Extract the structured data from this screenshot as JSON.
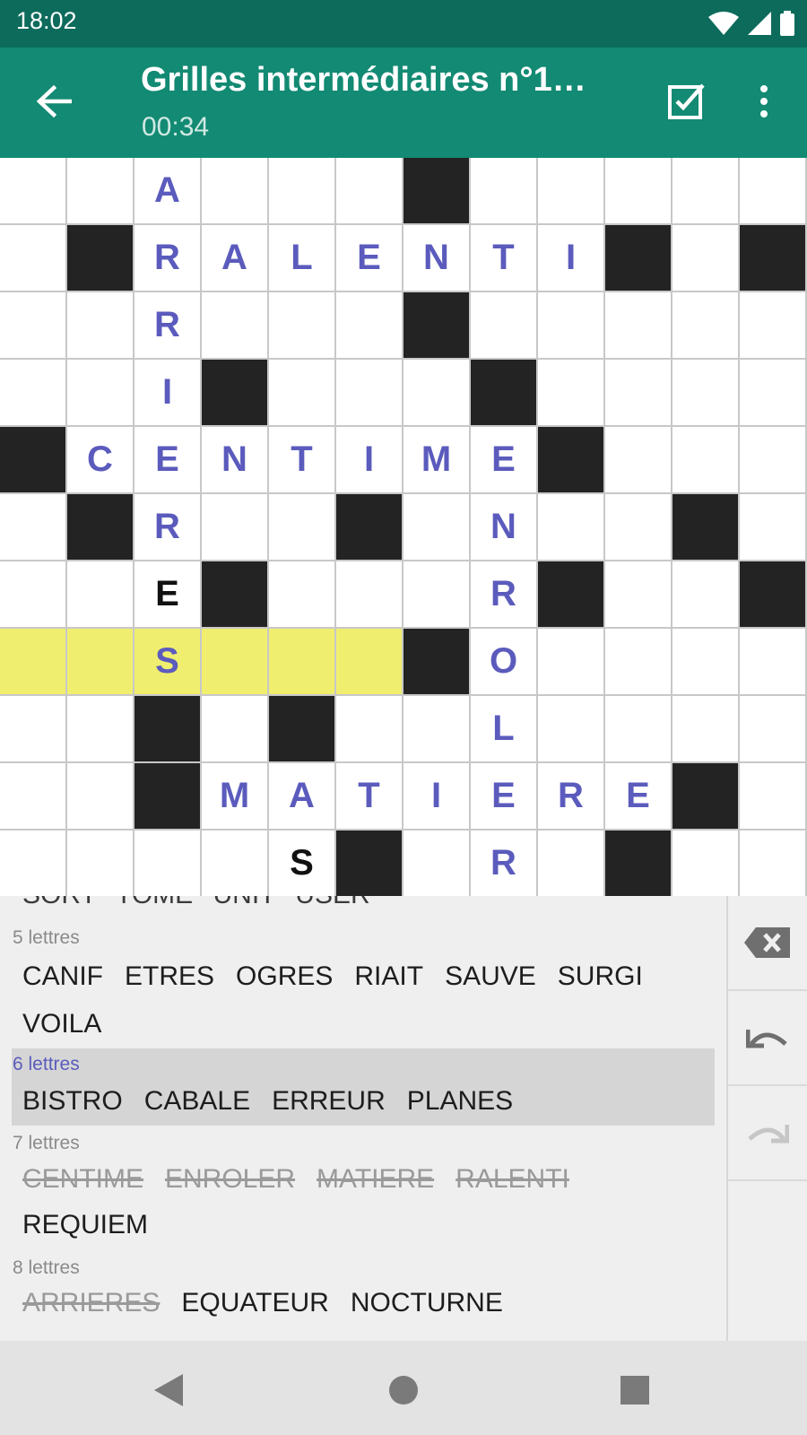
{
  "status_bar": {
    "time": "18:02"
  },
  "app_bar": {
    "title": "Grilles intermédiaires n°1…",
    "timer": "00:34"
  },
  "grid": {
    "rows": [
      [
        "",
        "",
        "A",
        "",
        "",
        "",
        "#",
        "",
        "",
        "",
        "",
        ""
      ],
      [
        "",
        "#",
        "R",
        "A",
        "L",
        "E",
        "N",
        "T",
        "I",
        "#",
        "",
        "#"
      ],
      [
        "",
        "",
        "R",
        "",
        "",
        "",
        "#",
        "",
        "",
        "",
        "",
        ""
      ],
      [
        "",
        "",
        "I",
        "#",
        "",
        "",
        "",
        "#",
        "",
        "",
        "",
        ""
      ],
      [
        "#",
        "C",
        "E",
        "N",
        "T",
        "I",
        "M",
        "E",
        "#",
        "",
        "",
        ""
      ],
      [
        "",
        "#",
        "R",
        "",
        "",
        "#",
        "",
        "N",
        "",
        "",
        "#",
        ""
      ],
      [
        "",
        "",
        "E*",
        "#",
        "",
        "",
        "",
        "R",
        "#",
        "",
        "",
        "#"
      ],
      [
        "~",
        "~",
        "S~",
        "~",
        "~",
        "~",
        "#",
        "O",
        "",
        "",
        "",
        ""
      ],
      [
        "",
        "",
        "#",
        "",
        "#",
        "",
        "",
        "L",
        "",
        "",
        "",
        ""
      ],
      [
        "",
        "",
        "#",
        "M",
        "A",
        "T",
        "I",
        "E",
        "R",
        "E",
        "#",
        ""
      ],
      [
        "",
        "",
        "",
        "",
        "S*",
        "#",
        "",
        "R",
        "",
        "#",
        "",
        ""
      ]
    ],
    "legend": "#=block, *=given letter (black), ~=highlighted row"
  },
  "word_list": {
    "cut_top_line": "SORT TOME UNIT USER",
    "groups": [
      {
        "label": "5 lettres",
        "lines": [
          [
            {
              "w": "CANIF",
              "done": false
            },
            {
              "w": "ETRES",
              "done": false
            },
            {
              "w": "OGRES",
              "done": false
            },
            {
              "w": "RIAIT",
              "done": false
            },
            {
              "w": "SAUVE",
              "done": false
            },
            {
              "w": "SURGI",
              "done": false
            }
          ],
          [
            {
              "w": "VOILA",
              "done": false
            }
          ]
        ]
      },
      {
        "label": "6 lettres",
        "active": true,
        "lines": [
          [
            {
              "w": "BISTRO",
              "done": false
            },
            {
              "w": "CABALE",
              "done": false
            },
            {
              "w": "ERREUR",
              "done": false
            },
            {
              "w": "PLANES",
              "done": false
            }
          ]
        ]
      },
      {
        "label": "7 lettres",
        "lines": [
          [
            {
              "w": "CENTIME",
              "done": true
            },
            {
              "w": "ENROLER",
              "done": true
            },
            {
              "w": "MATIERE",
              "done": true
            },
            {
              "w": "RALENTI",
              "done": true
            }
          ],
          [
            {
              "w": "REQUIEM",
              "done": false
            }
          ]
        ]
      },
      {
        "label": "8 lettres",
        "lines": [
          [
            {
              "w": "ARRIERES",
              "done": true
            },
            {
              "w": "EQUATEUR",
              "done": false
            },
            {
              "w": "NOCTURNE",
              "done": false
            }
          ]
        ]
      }
    ]
  },
  "actions": [
    "backspace-icon",
    "undo-icon",
    "redo-icon"
  ],
  "nav": [
    "nav-back-icon",
    "nav-home-icon",
    "nav-recents-icon"
  ],
  "colors": {
    "status_bar": "#0d6b5c",
    "app_bar": "#138a73",
    "entered_letter": "#5b5bbd",
    "highlight": "#f0ee6e"
  }
}
